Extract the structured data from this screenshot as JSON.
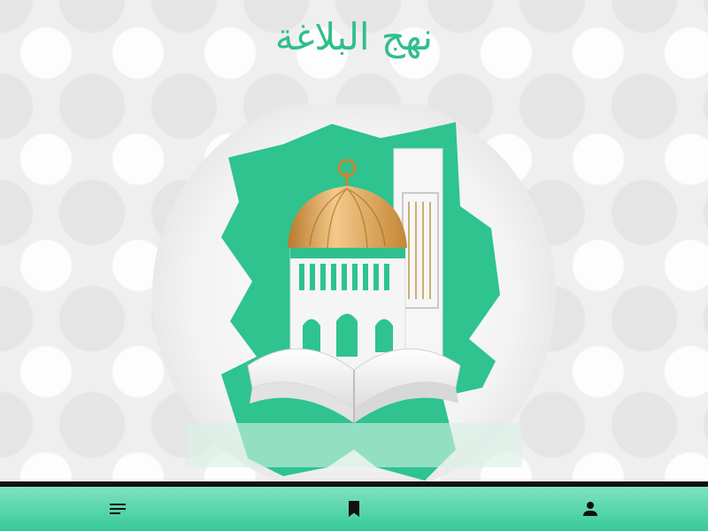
{
  "app": {
    "title": "نهج البلاغة",
    "brand_color": "#2fbf8a"
  },
  "hero": {
    "icon": "mosque-with-open-book-illustration",
    "accent": "#2ec38f",
    "dome": "#d9a85a"
  },
  "bottom_nav": {
    "background_top": "#7fe3c2",
    "background_bottom": "#36c999",
    "items": [
      {
        "icon": "menu-icon"
      },
      {
        "icon": "bookmark-icon"
      },
      {
        "icon": "person-icon"
      }
    ]
  }
}
